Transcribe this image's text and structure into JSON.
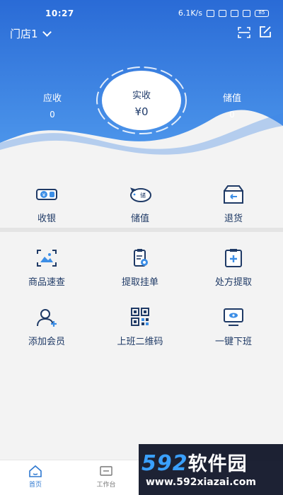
{
  "status_bar": {
    "time": "10:27",
    "network_speed": "6.1K/s",
    "battery": "85"
  },
  "header": {
    "store_label": "门店1",
    "colors": {
      "gradient_top": "#2b6fd8",
      "gradient_bottom": "#4a92ea"
    }
  },
  "stats": {
    "receivable": {
      "label": "应收",
      "value": "0"
    },
    "received": {
      "label": "实收",
      "value": "¥0"
    },
    "stored": {
      "label": "储值",
      "value": "0"
    }
  },
  "top_actions": [
    {
      "label": "收银",
      "icon": "cash-icon"
    },
    {
      "label": "储值",
      "icon": "piggy-bank-icon"
    },
    {
      "label": "退货",
      "icon": "return-box-icon"
    }
  ],
  "main_actions": [
    {
      "label": "商品速查",
      "icon": "product-lookup-icon"
    },
    {
      "label": "提取挂单",
      "icon": "pending-order-icon"
    },
    {
      "label": "处方提取",
      "icon": "prescription-icon"
    },
    {
      "label": "添加会员",
      "icon": "add-member-icon"
    },
    {
      "label": "上班二维码",
      "icon": "qr-code-icon"
    },
    {
      "label": "一键下班",
      "icon": "clock-out-icon"
    }
  ],
  "bottom_nav": {
    "home": "首页",
    "workbench": "工作台"
  },
  "watermark": {
    "brand_digits": "592",
    "brand_text": "软件园",
    "url": "www.592xiazai.com"
  }
}
